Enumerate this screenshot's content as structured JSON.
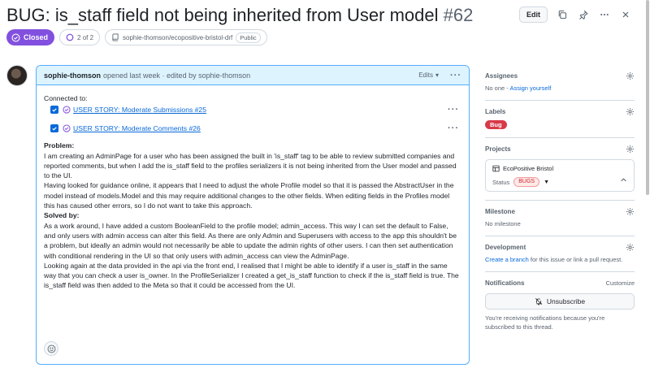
{
  "issue": {
    "title": "BUG: is_staff field not being inherited from User model",
    "number": "#62",
    "state": "Closed",
    "subissues": "2 of 2",
    "repo": "sophie-thomson/ecopositive-bristol-drf",
    "visibility": "Public"
  },
  "header": {
    "edit_label": "Edit"
  },
  "comment": {
    "author": "sophie-thomson",
    "meta": "opened last week · edited by sophie-thomson",
    "edits_label": "Edits",
    "connected_label": "Connected to:",
    "tasks": [
      {
        "label": "USER STORY: Moderate Submissions #25"
      },
      {
        "label": "USER STORY: Moderate Comments #26"
      }
    ],
    "problem_heading": "Problem:",
    "problem_p1": "I am creating an AdminPage for a user who has been assigned the built in 'is_staff' tag to be able to review submitted companies and reported comments, but when I add the is_staff field to the profiles serializers it is not being inherited from the User model and passed to the UI.",
    "problem_p2": "Having looked for guidance online, it appears that I need to adjust the whole Profile model so that it is passed the AbstractUser in the model instead of models.Model and this may require additional changes to the other fields. When editing fields in the Profiles model this has caused other errors, so I do not want to take this approach.",
    "solved_heading": "Solved by:",
    "solved_p1": "As a work around, I have added a custom BooleanField to the profile model; admin_access. This way I can set the default to False, and only users with admin access can alter this field. As there are only Admin and Superusers with access to the app this shouldn't be a problem, but ideally an admin would not necessarily be able to update the admin rights of other users. I can then set authentication with conditional rendering in the UI so that only users with admin_access can view the AdminPage.",
    "solved_p2": "Looking again at the data provided in the api via the front end, I realised that I might be able to identify if a user is_staff in the same way that you can check a user is_owner. In the ProfileSerializer I created a get_is_staff function to check if the is_staff field is true. The is_staff field was then added to the Meta so that it could be accessed from the UI."
  },
  "sidebar": {
    "assignees_title": "Assignees",
    "assignees_none": "No one -",
    "assign_yourself": "Assign yourself",
    "labels_title": "Labels",
    "label_bug": "Bug",
    "projects_title": "Projects",
    "project_name": "EcoPositive Bristol",
    "status_label": "Status",
    "status_value": "BUGS",
    "milestone_title": "Milestone",
    "milestone_value": "No milestone",
    "development_title": "Development",
    "create_branch": "Create a branch",
    "development_suffix": "for this issue or link a pull request.",
    "notifications_title": "Notifications",
    "customize": "Customize",
    "unsubscribe": "Unsubscribe",
    "notif_note": "You're receiving notifications because you're subscribed to this thread."
  },
  "colors": {
    "closed_purple": "#8250df",
    "link_blue": "#0969da",
    "bug_red": "#d73a4a"
  }
}
